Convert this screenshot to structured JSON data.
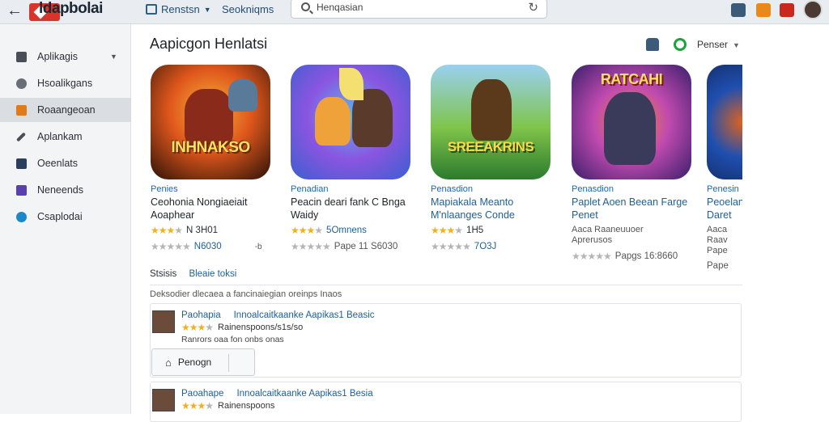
{
  "topbar": {
    "brand": "ldapbolai",
    "nav1": "Renstsn",
    "nav2": "Seokniqms",
    "search_value": "Henqasian"
  },
  "sidebar": {
    "items": [
      {
        "label": "Aplikagis",
        "color": "#4a4f57"
      },
      {
        "label": "Hsoalikgans",
        "color": "#4a4f57"
      },
      {
        "label": "Roaangeoan",
        "color": "#e07b1a"
      },
      {
        "label": "Aplankam",
        "color": "#4a4f57"
      },
      {
        "label": "Oeenlats",
        "color": "#2c3e60"
      },
      {
        "label": "Neneends",
        "color": "#5a3fb0"
      },
      {
        "label": "Csaplodai",
        "color": "#1d88c8"
      }
    ]
  },
  "main": {
    "title": "Aapicgon Henlatsi",
    "filter_label": "Penser",
    "apps": [
      {
        "art": "INHNAKSO",
        "category": "Penies",
        "name": "Ceohonia Nongiaeiait Aoaphear",
        "rating": "N 3H01",
        "stars": 3,
        "rating2": "N6030",
        "extra": "-b",
        "colors": [
          "#2b1208",
          "#e0571c",
          "#f3b33a"
        ]
      },
      {
        "art": "",
        "category": "Penadian",
        "name": "Peacin deari fank C Bnga Waidy",
        "rating": "5Omnens",
        "stars": 3,
        "rating2": "Pape 11 S6030",
        "extra": "",
        "colors": [
          "#3a5fd0",
          "#8a55e0",
          "#57b8f0"
        ]
      },
      {
        "art": "SREEAKRINS",
        "category": "Penasdion",
        "name": "Mapiakala Meanto M'nlaanges Conde",
        "rating": "1H5",
        "stars": 3,
        "rating2": "7O3J",
        "extra": "",
        "colors": [
          "#2c7a2e",
          "#7fc44a",
          "#9ad0f0"
        ]
      },
      {
        "art": "RATCAHI",
        "category": "Penasdion",
        "name": "Paplet Aoen Beean Farge Penet",
        "rating": "Aaca Raaneuuoer Aprerusos",
        "stars": 0,
        "rating2": "Papgs 16:8660",
        "extra": "",
        "colors": [
          "#3a1f6a",
          "#c04ab0",
          "#f08a2a"
        ]
      },
      {
        "art": "",
        "category": "Penesin",
        "name": "Peoelanse Daret",
        "rating": "Aaca Raav Pape",
        "stars": 0,
        "rating2": "Pape",
        "extra": "",
        "colors": [
          "#0c1230",
          "#1f4fb0",
          "#e0621c"
        ]
      }
    ],
    "status_label": "Stsisis",
    "status_value": "Bleaie toksi",
    "sub_desc": "Deksodier dlecaea a fancinaiegian oreinps Inaos",
    "reviews": [
      {
        "name": "Paohapia",
        "title": "Innoalcaitkaanke Aapikas1 Beasic",
        "meta": "Rainenspoons/s1s/so",
        "text": "Ranrors oaa fon onbs onas",
        "button": "Penogn"
      },
      {
        "name": "Paoahape",
        "title": "Innoalcaitkaanke Aapikas1 Besia",
        "meta": "Rainenspoons"
      }
    ]
  }
}
